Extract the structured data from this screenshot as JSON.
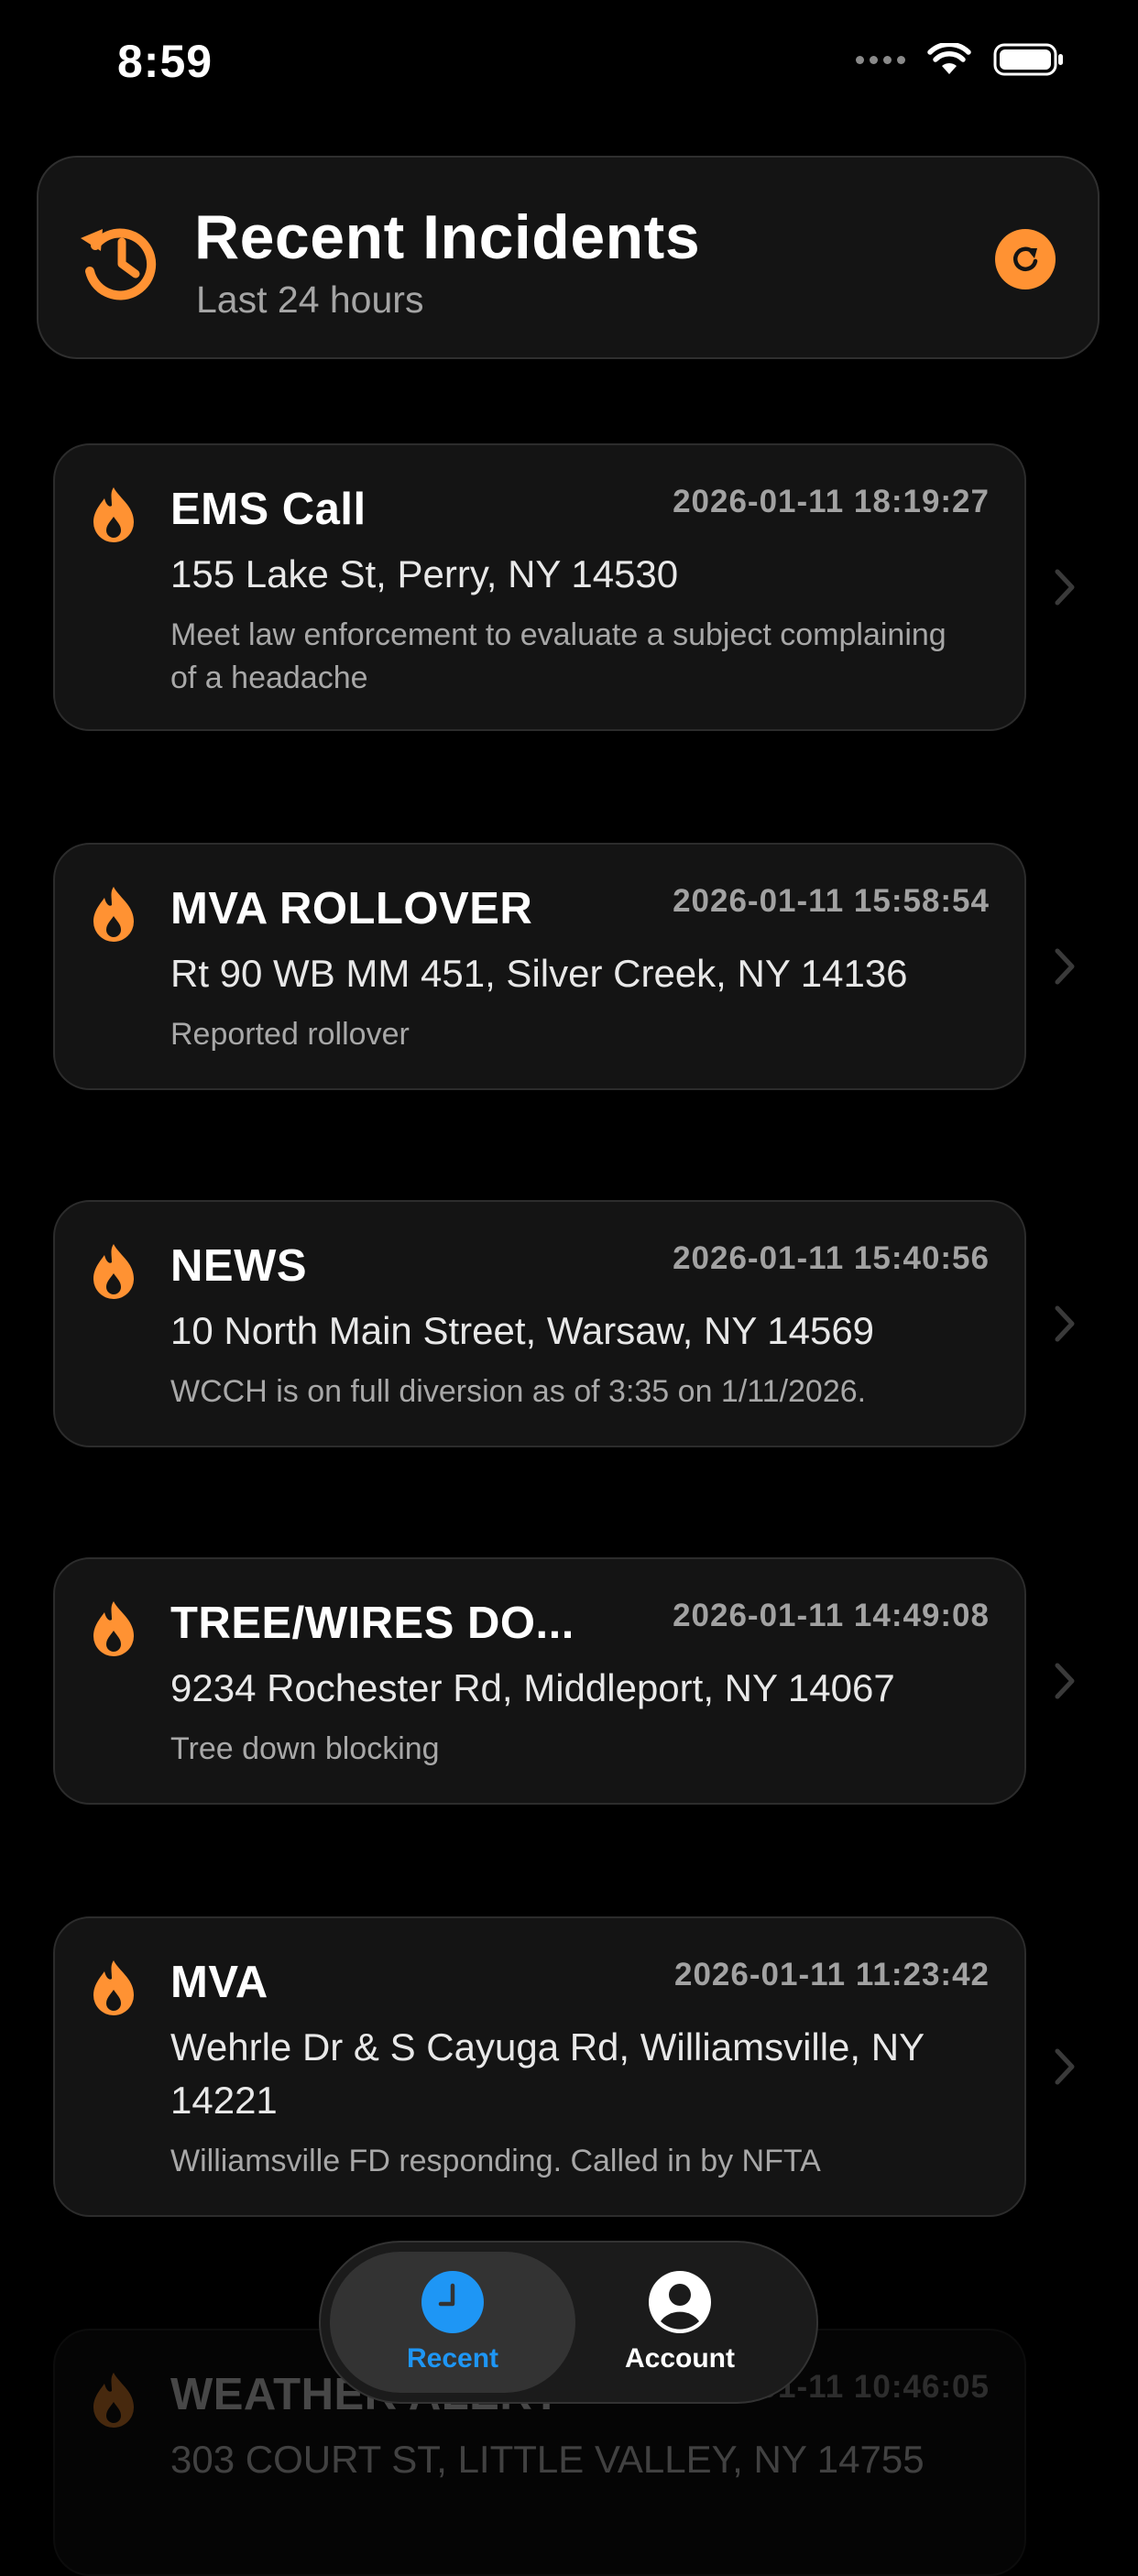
{
  "status_bar": {
    "time": "8:59"
  },
  "header": {
    "title": "Recent Incidents",
    "subtitle": "Last 24 hours",
    "icon": "history-clock-icon",
    "action_icon": "refresh-icon",
    "accent_color": "#ff9233"
  },
  "incidents": [
    {
      "title": "EMS Call",
      "timestamp": "2026-01-11 18:19:27",
      "address": "155 Lake St, Perry, NY 14530",
      "description": "Meet law enforcement to evaluate a subject complaining of a headache"
    },
    {
      "title": "MVA ROLLOVER",
      "timestamp": "2026-01-11 15:58:54",
      "address": "Rt 90 WB MM 451, Silver Creek, NY 14136",
      "description": "Reported rollover"
    },
    {
      "title": "NEWS",
      "timestamp": "2026-01-11 15:40:56",
      "address": "10 North Main Street, Warsaw, NY 14569",
      "description": "WCCH is on full diversion as of 3:35 on 1/11/2026."
    },
    {
      "title": "TREE/WIRES DO...",
      "timestamp": "2026-01-11 14:49:08",
      "address": "9234 Rochester Rd, Middleport, NY 14067",
      "description": "Tree down blocking"
    },
    {
      "title": "MVA",
      "timestamp": "2026-01-11 11:23:42",
      "address": "Wehrle Dr & S Cayuga Rd, Williamsville, NY 14221",
      "description": "Williamsville FD responding. Called in by NFTA"
    },
    {
      "title": "WEATHER ALERT",
      "timestamp": "2026-01-11 10:46:05",
      "address": "303 COURT ST, LITTLE VALLEY, NY 14755",
      "description": ""
    }
  ],
  "tab_bar": {
    "tabs": [
      {
        "label": "Recent",
        "icon": "clock-icon",
        "active": true,
        "color": "#1e96f5"
      },
      {
        "label": "Account",
        "icon": "account-icon",
        "active": false,
        "color": "#ffffff"
      }
    ]
  }
}
